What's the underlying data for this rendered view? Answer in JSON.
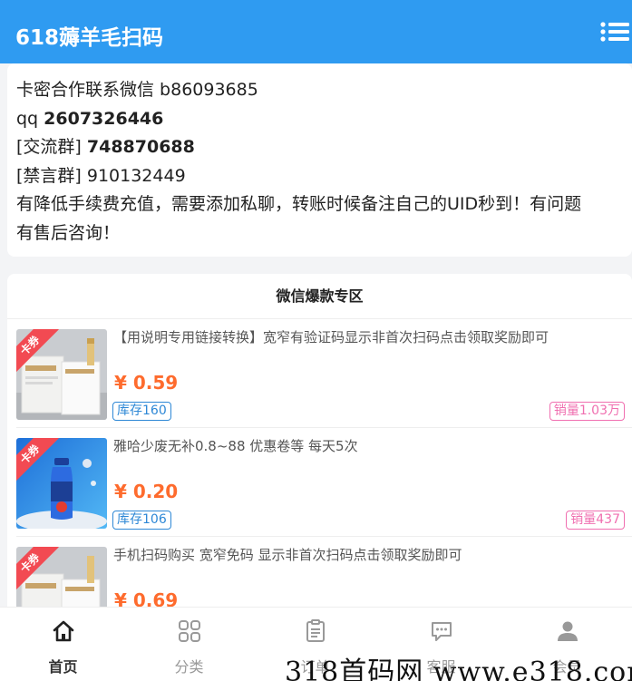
{
  "header": {
    "title": "618薅羊毛扫码",
    "menu_icon": "list-menu-icon"
  },
  "notice": {
    "line1": "卡密合作联系微信 b86093685",
    "line2_prefix": "qq ",
    "line2_value": "2607326446",
    "line3_prefix": "[交流群] ",
    "line3_value": "748870688",
    "line4": "[禁言群] 910132449",
    "line5": "有降低手续费充值，需要添加私聊，转账时候备注自己的UID秒到！有问题",
    "line6": "有售后咨询！"
  },
  "products": {
    "section_title": "微信爆款专区",
    "items": [
      {
        "ribbon": "卡券",
        "name": "【用说明专用链接转换】宽窄有验证码显示非首次扫码点击领取奖励即可",
        "price": "¥ 0.59",
        "stock": "库存160",
        "sales": "销量1.03万"
      },
      {
        "ribbon": "卡券",
        "name": "雅哈少废无补0.8~88 优惠卷等 每天5次",
        "price": "¥ 0.20",
        "stock": "库存106",
        "sales": "销量437"
      },
      {
        "ribbon": "卡券",
        "name": "手机扫码购买 宽窄免码 显示非首次扫码点击领取奖励即可",
        "price": "¥ 0.69",
        "stock": "",
        "sales": ""
      }
    ]
  },
  "nav": {
    "items": [
      {
        "label": "首页",
        "icon": "home-icon",
        "active": true
      },
      {
        "label": "分类",
        "icon": "grid-icon",
        "active": false
      },
      {
        "label": "订单",
        "icon": "order-icon",
        "active": false
      },
      {
        "label": "客服",
        "icon": "chat-icon",
        "active": false
      },
      {
        "label": "会员",
        "icon": "user-icon",
        "active": false
      }
    ]
  },
  "watermark": "318首码网 www.e318.com",
  "colors": {
    "header_bg": "#2f9bf1",
    "price": "#fe6b2d",
    "stock": "#2e88d6",
    "sales": "#f06fb0",
    "ribbon": "#f24a52"
  }
}
